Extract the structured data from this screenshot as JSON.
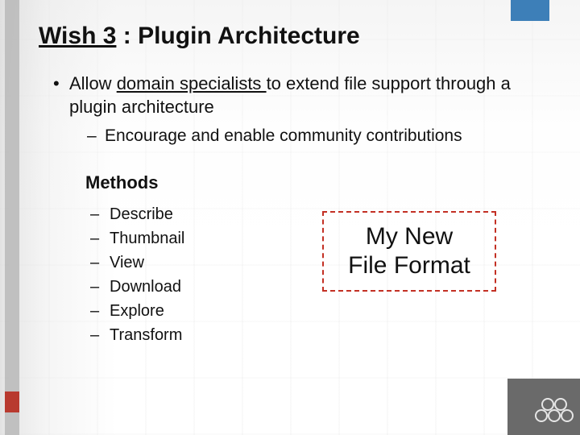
{
  "title": {
    "underlined": "Wish 3",
    "rest": " : Plugin Architecture"
  },
  "main_bullet": {
    "prefix": "Allow ",
    "underlined": "domain specialists ",
    "suffix": "to extend file support through a plugin architecture"
  },
  "sub_bullet": "Encourage and enable community contributions",
  "methods_heading": "Methods",
  "methods": [
    "Describe",
    "Thumbnail",
    "View",
    "Download",
    "Explore",
    "Transform"
  ],
  "callout": {
    "line1": "My New",
    "line2": "File Format"
  }
}
